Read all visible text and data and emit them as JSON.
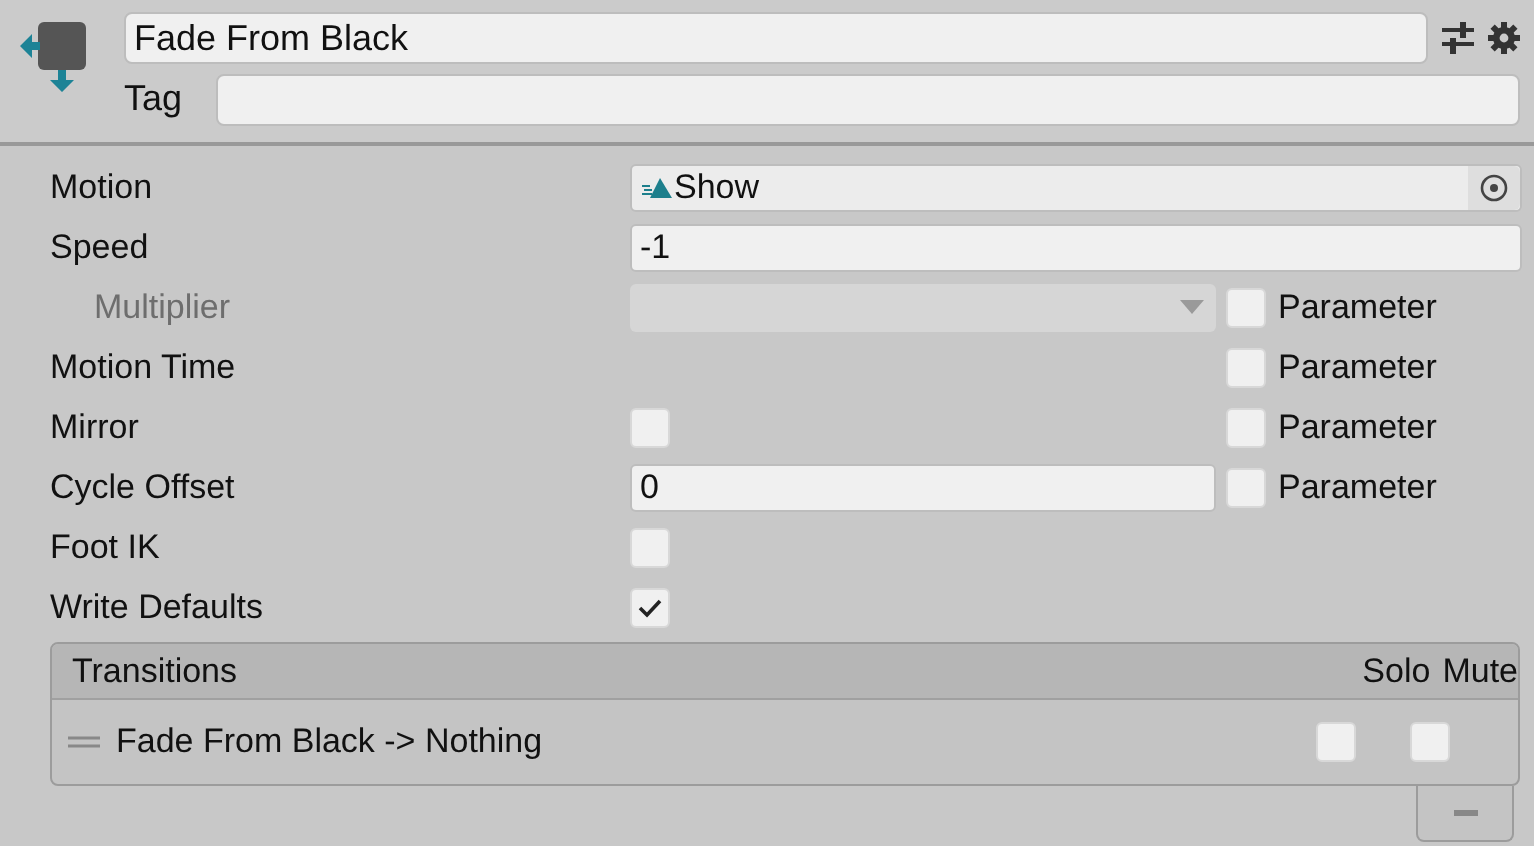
{
  "header": {
    "name": "Fade From Black",
    "tag_label": "Tag"
  },
  "properties": [
    {
      "label": "Motion",
      "kind": "object",
      "value": "Show",
      "indented": false,
      "disabled": false
    },
    {
      "label": "Speed",
      "kind": "number",
      "value": "-1",
      "indented": false,
      "disabled": false
    },
    {
      "label": "Multiplier",
      "kind": "dropdown",
      "indented": true,
      "disabled": true,
      "parameter": {
        "label": "Parameter",
        "checked": false
      }
    },
    {
      "label": "Motion Time",
      "kind": "empty",
      "indented": false,
      "disabled": false,
      "parameter": {
        "label": "Parameter",
        "checked": false
      }
    },
    {
      "label": "Mirror",
      "kind": "checkbox",
      "checked": false,
      "indented": false,
      "disabled": false,
      "parameter": {
        "label": "Parameter",
        "checked": false
      }
    },
    {
      "label": "Cycle Offset",
      "kind": "number",
      "value": "0",
      "indented": false,
      "disabled": false,
      "parameter": {
        "label": "Parameter",
        "checked": false
      }
    },
    {
      "label": "Foot IK",
      "kind": "checkbox",
      "checked": false,
      "indented": false,
      "disabled": false
    },
    {
      "label": "Write Defaults",
      "kind": "checkbox",
      "checked": true,
      "indented": false,
      "disabled": false
    }
  ],
  "transitions": {
    "title": "Transitions",
    "columns": [
      "Solo",
      "Mute"
    ],
    "rows": [
      {
        "label": "Fade From Black -> Nothing",
        "solo": false,
        "mute": false
      }
    ]
  }
}
